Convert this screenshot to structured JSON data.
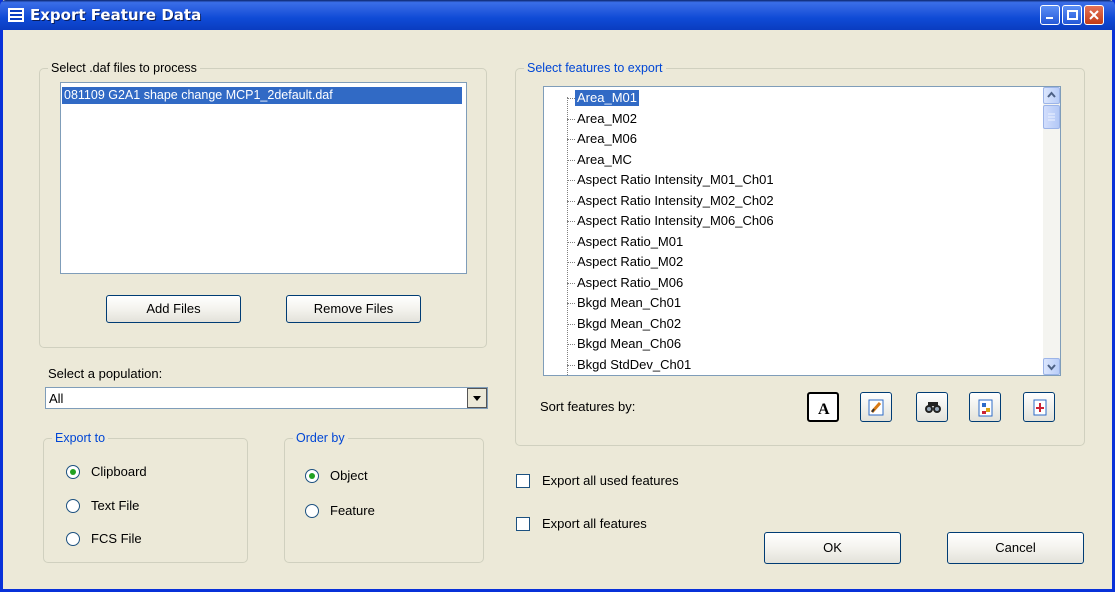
{
  "window": {
    "title": "Export Feature Data"
  },
  "files_group": {
    "legend": "Select .daf files to process",
    "files": [
      "081109 G2A1 shape change MCP1_2default.daf"
    ],
    "add_label": "Add Files",
    "remove_label": "Remove Files"
  },
  "population": {
    "label": "Select a population:",
    "value": "All"
  },
  "export_to": {
    "legend": "Export to",
    "options": [
      "Clipboard",
      "Text File",
      "FCS File"
    ],
    "selected": "Clipboard"
  },
  "order_by": {
    "legend": "Order by",
    "options": [
      "Object",
      "Feature"
    ],
    "selected": "Object"
  },
  "features_group": {
    "legend": "Select features to export",
    "items": [
      "Area_M01",
      "Area_M02",
      "Area_M06",
      "Area_MC",
      "Aspect Ratio Intensity_M01_Ch01",
      "Aspect Ratio Intensity_M02_Ch02",
      "Aspect Ratio Intensity_M06_Ch06",
      "Aspect Ratio_M01",
      "Aspect Ratio_M02",
      "Aspect Ratio_M06",
      "Bkgd Mean_Ch01",
      "Bkgd Mean_Ch02",
      "Bkgd Mean_Ch06",
      "Bkgd StdDev_Ch01"
    ],
    "selected": "Area_M01",
    "sort_label": "Sort features by:",
    "sort_icons": [
      "alphabetical-sort-icon",
      "edit-sort-icon",
      "binoculars-sort-icon",
      "category-sort-icon",
      "combined-sort-icon"
    ]
  },
  "options": {
    "export_used_label": "Export all used features",
    "export_all_label": "Export all features"
  },
  "buttons": {
    "ok": "OK",
    "cancel": "Cancel"
  },
  "colors": {
    "titlebar": "#0a3cc0",
    "selection": "#316ac5",
    "group_legend_blue": "#0046d5",
    "face": "#ece9d8"
  }
}
